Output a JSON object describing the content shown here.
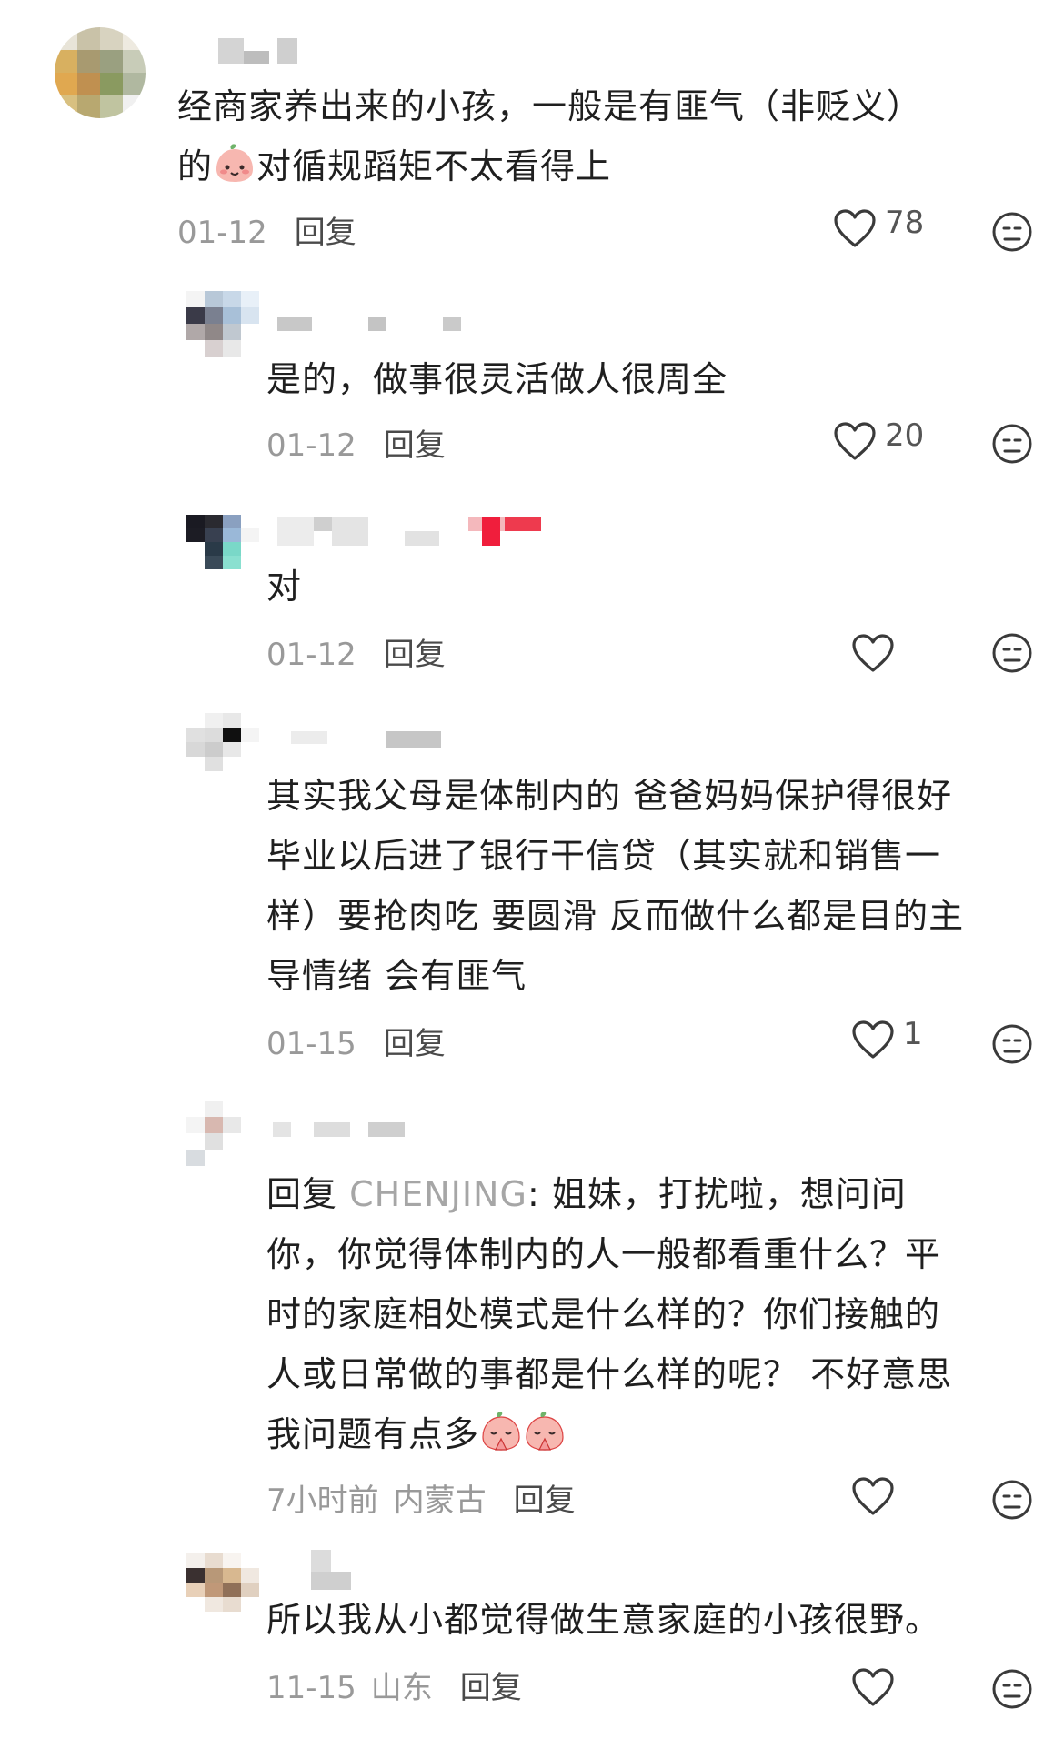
{
  "icons": {
    "like": "heart-outline-icon",
    "dislike": "meh-face-icon",
    "emoji": "peach-face-emoji"
  },
  "comments": [
    {
      "text_lines": [
        "经商家养出来的小孩，一般是有匪气（非贬义）",
        "的",
        "对循规蹈矩不太看得上"
      ],
      "date": "01-12",
      "reply_label": "回复",
      "likes": "78"
    },
    {
      "text": "是的，做事很灵活做人很周全",
      "date": "01-12",
      "reply_label": "回复",
      "likes": "20"
    },
    {
      "text": "对",
      "date": "01-12",
      "reply_label": "回复",
      "likes": ""
    },
    {
      "text_lines": [
        "其实我父母是体制内的 爸爸妈妈保护得很好",
        "毕业以后进了银行干信贷（其实就和销售一",
        "样）要抢肉吃 要圆滑 反而做什么都是目的主",
        "导情绪 会有匪气"
      ],
      "date": "01-15",
      "reply_label": "回复",
      "likes": "1"
    },
    {
      "reply_prefix": "回复 ",
      "reply_target": "CHENJING",
      "text_lines": [
        ": 姐妹，打扰啦，想问问",
        "你，你觉得体制内的人一般都看重什么？平",
        "时的家庭相处模式是什么样的？你们接触的",
        "人或日常做的事都是什么样的呢？ 不好意思",
        "我问题有点多"
      ],
      "date": "7小时前",
      "location": "内蒙古",
      "reply_label": "回复",
      "likes": ""
    },
    {
      "text": "所以我从小都觉得做生意家庭的小孩很野。",
      "date": "11-15",
      "location": "山东",
      "reply_label": "回复",
      "likes": ""
    }
  ]
}
